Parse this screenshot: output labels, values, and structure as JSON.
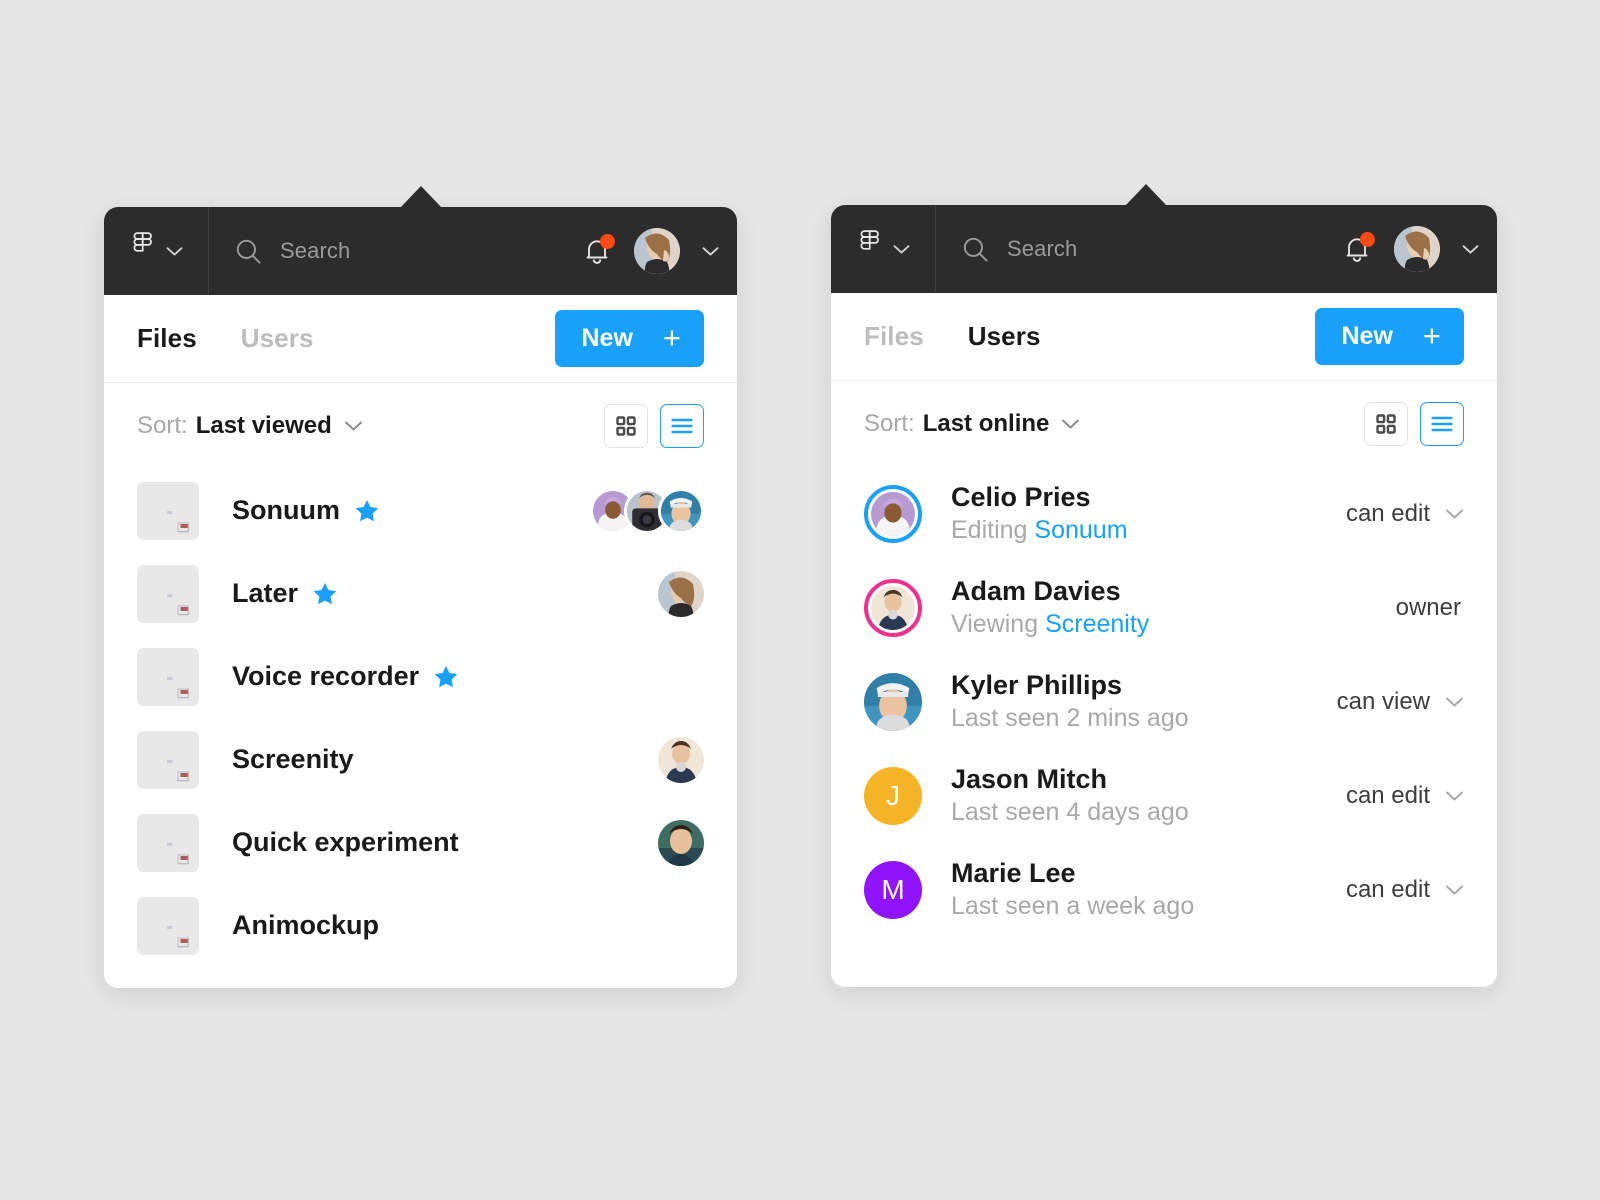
{
  "theme": {
    "accent": "#18a0fb",
    "topbar_bg": "#2c2c2c",
    "page_bg": "#e6e6e6",
    "badge": "#ff4a14",
    "muted": "#a8a8a8",
    "star": "#18a0fb",
    "ring_blue": "#18a0fb",
    "ring_pink": "#f0308c",
    "avatar_amber": "#f5b425",
    "avatar_purple": "#9013fe"
  },
  "panels": [
    {
      "id": "files-panel",
      "topbar": {
        "brand_icon": "figma-logo-icon",
        "brand_chevron_icon": "chevron-down-icon",
        "search_icon": "search-icon",
        "search_placeholder": "Search",
        "search_value": "",
        "bell_icon": "bell-icon",
        "bell_has_badge": true,
        "avatar_icon": "avatar",
        "avatar_chevron_icon": "chevron-down-icon"
      },
      "tabs": [
        {
          "label": "Files",
          "active": true
        },
        {
          "label": "Users",
          "active": false
        }
      ],
      "new_button": {
        "label": "New",
        "icon": "plus-icon"
      },
      "sort": {
        "label": "Sort:",
        "value": "Last viewed",
        "chevron_icon": "chevron-down-icon"
      },
      "view_toggle": {
        "grid": {
          "icon": "grid-view-icon",
          "selected": false
        },
        "list": {
          "icon": "list-view-icon",
          "selected": true
        }
      },
      "files": [
        {
          "name": "Sonuum",
          "starred": true,
          "thumb": 1,
          "collaborators": [
            "p1",
            "p2",
            "p3"
          ]
        },
        {
          "name": "Later",
          "starred": true,
          "thumb": 2,
          "collaborators": [
            "p4"
          ]
        },
        {
          "name": "Voice recorder",
          "starred": true,
          "thumb": 3,
          "collaborators": []
        },
        {
          "name": "Screenity",
          "starred": false,
          "thumb": 4,
          "collaborators": [
            "p5"
          ]
        },
        {
          "name": "Quick experiment",
          "starred": false,
          "thumb": 5,
          "collaborators": [
            "p6"
          ]
        },
        {
          "name": "Animockup",
          "starred": false,
          "thumb": 6,
          "collaborators": []
        }
      ]
    },
    {
      "id": "users-panel",
      "topbar": {
        "brand_icon": "figma-logo-icon",
        "brand_chevron_icon": "chevron-down-icon",
        "search_icon": "search-icon",
        "search_placeholder": "Search",
        "search_value": "",
        "bell_icon": "bell-icon",
        "bell_has_badge": true,
        "avatar_icon": "avatar",
        "avatar_chevron_icon": "chevron-down-icon"
      },
      "tabs": [
        {
          "label": "Files",
          "active": false
        },
        {
          "label": "Users",
          "active": true
        }
      ],
      "new_button": {
        "label": "New",
        "icon": "plus-icon"
      },
      "sort": {
        "label": "Sort:",
        "value": "Last online",
        "chevron_icon": "chevron-down-icon"
      },
      "view_toggle": {
        "grid": {
          "icon": "grid-view-icon",
          "selected": false
        },
        "list": {
          "icon": "list-view-icon",
          "selected": true
        }
      },
      "users": [
        {
          "name": "Celio Pries",
          "status_prefix": "Editing",
          "status_file": "Sonuum",
          "status_plain": "",
          "permission": "can edit",
          "permission_has_chevron": true,
          "avatar_kind": "photo",
          "avatar_ring": "#18a0fb"
        },
        {
          "name": "Adam Davies",
          "status_prefix": "Viewing",
          "status_file": "Screenity",
          "status_plain": "",
          "permission": "owner",
          "permission_has_chevron": false,
          "avatar_kind": "photo",
          "avatar_ring": "#f0308c"
        },
        {
          "name": "Kyler Phillips",
          "status_prefix": "",
          "status_file": "",
          "status_plain": "Last seen 2 mins ago",
          "permission": "can view",
          "permission_has_chevron": true,
          "avatar_kind": "photo",
          "avatar_ring": ""
        },
        {
          "name": "Jason Mitch",
          "status_prefix": "",
          "status_file": "",
          "status_plain": "Last seen 4 days ago",
          "permission": "can edit",
          "permission_has_chevron": true,
          "avatar_kind": "letter",
          "avatar_letter": "J",
          "avatar_color": "#f5b425",
          "avatar_ring": ""
        },
        {
          "name": "Marie Lee",
          "status_prefix": "",
          "status_file": "",
          "status_plain": "Last seen a week ago",
          "permission": "can edit",
          "permission_has_chevron": true,
          "avatar_kind": "letter",
          "avatar_letter": "M",
          "avatar_color": "#9013fe",
          "avatar_ring": ""
        }
      ]
    }
  ]
}
